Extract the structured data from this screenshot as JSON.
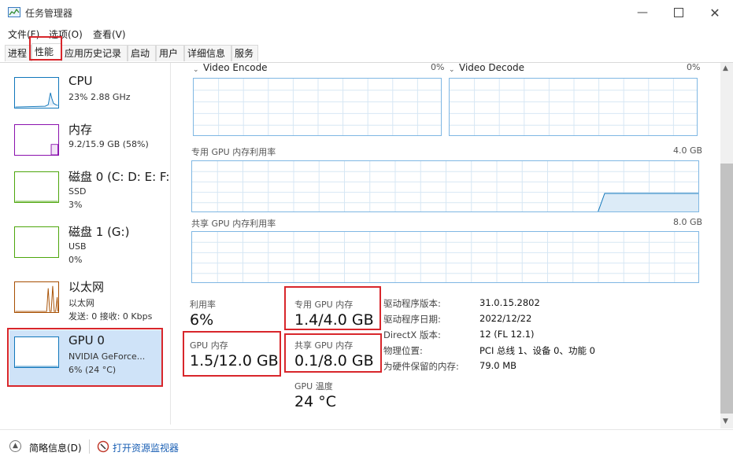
{
  "window": {
    "title": "任务管理器",
    "minimize_icon": "minimize-icon",
    "maximize_icon": "maximize-icon",
    "close_icon": "close-icon"
  },
  "menu": [
    "文件(F)",
    "选项(O)",
    "查看(V)"
  ],
  "tabs": [
    "进程",
    "性能",
    "应用历史记录",
    "启动",
    "用户",
    "详细信息",
    "服务"
  ],
  "active_tab": "性能",
  "sidebar": [
    {
      "title": "CPU",
      "lines": [
        "23%  2.88 GHz"
      ],
      "color": "#1177bb"
    },
    {
      "title": "内存",
      "lines": [
        "9.2/15.9 GB (58%)"
      ],
      "color": "#8b12ae"
    },
    {
      "title": "磁盘 0 (C: D: E: F:",
      "lines": [
        "SSD",
        "3%"
      ],
      "color": "#4da60c"
    },
    {
      "title": "磁盘 1 (G:)",
      "lines": [
        "USB",
        "0%"
      ],
      "color": "#4da60c"
    },
    {
      "title": "以太网",
      "lines": [
        "以太网",
        "发送: 0 接收: 0 Kbps"
      ],
      "color": "#a74f01"
    },
    {
      "title": "GPU 0",
      "lines": [
        "NVIDIA GeForce...",
        "6%  (24 °C)"
      ],
      "color": "#1177bb"
    }
  ],
  "graphs": {
    "video_encode": {
      "label": "Video Encode",
      "percent": "0%"
    },
    "video_decode": {
      "label": "Video Decode",
      "percent": "0%"
    },
    "dedicated": {
      "label": "专用 GPU 内存利用率",
      "max": "4.0 GB"
    },
    "shared": {
      "label": "共享 GPU 内存利用率",
      "max": "8.0 GB"
    }
  },
  "stats": {
    "utilization": {
      "label": "利用率",
      "value": "6%"
    },
    "gpu_memory": {
      "label": "GPU 内存",
      "value": "1.5/12.0 GB"
    },
    "dedicated_memory": {
      "label": "专用 GPU 内存",
      "value": "1.4/4.0 GB"
    },
    "shared_memory": {
      "label": "共享 GPU 内存",
      "value": "0.1/8.0 GB"
    },
    "temperature": {
      "label": "GPU 温度",
      "value": "24 °C"
    }
  },
  "properties": [
    {
      "key": "驱动程序版本:",
      "value": "31.0.15.2802"
    },
    {
      "key": "驱动程序日期:",
      "value": "2022/12/22"
    },
    {
      "key": "DirectX 版本:",
      "value": "12 (FL 12.1)"
    },
    {
      "key": "物理位置:",
      "value": "PCI 总线 1、设备 0、功能 0"
    },
    {
      "key": "为硬件保留的内存:",
      "value": "79.0 MB"
    }
  ],
  "footer": {
    "fewer_details": "简略信息(D)",
    "resource_monitor": "打开资源监视器"
  }
}
